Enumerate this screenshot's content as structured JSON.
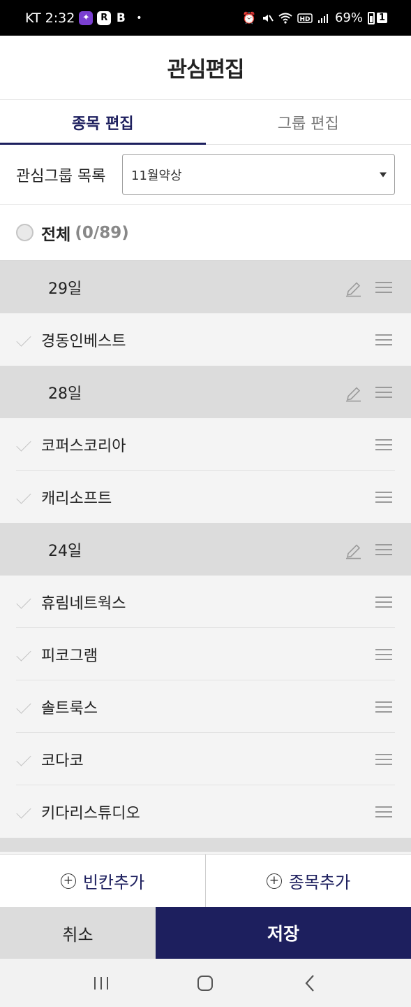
{
  "status_bar": {
    "carrier_time": "KT 2:32",
    "app_icon_r": "R",
    "app_icon_b": "B",
    "dot": "•",
    "battery_percent": "69%",
    "battery_badge": "1",
    "icons": [
      "alarm-icon",
      "mute-icon",
      "wifi-icon",
      "hd-icon",
      "signal-icon",
      "battery-icon"
    ]
  },
  "header": {
    "title": "관심편집"
  },
  "tabs": [
    {
      "label": "종목 편집",
      "active": true
    },
    {
      "label": "그룹 편집",
      "active": false
    }
  ],
  "group_select": {
    "label": "관심그룹 목록",
    "value": "11월약상"
  },
  "all_row": {
    "label": "전체",
    "count": "(0/89)"
  },
  "list": {
    "groups": [
      {
        "label": "29일",
        "items": [
          "경동인베스트"
        ]
      },
      {
        "label": "28일",
        "items": [
          "코퍼스코리아",
          "캐리소프트"
        ]
      },
      {
        "label": "24일",
        "items": [
          "휴림네트웍스",
          "피코그램",
          "솔트룩스",
          "코다코",
          "키다리스튜디오"
        ]
      }
    ]
  },
  "add_bar": {
    "add_blank": "빈칸추가",
    "add_stock": "종목추가"
  },
  "actions": {
    "cancel": "취소",
    "save": "저장"
  },
  "colors": {
    "accent": "#1d1f5e",
    "group_row_bg": "#dcdcdc",
    "item_row_bg": "#f4f4f4"
  }
}
